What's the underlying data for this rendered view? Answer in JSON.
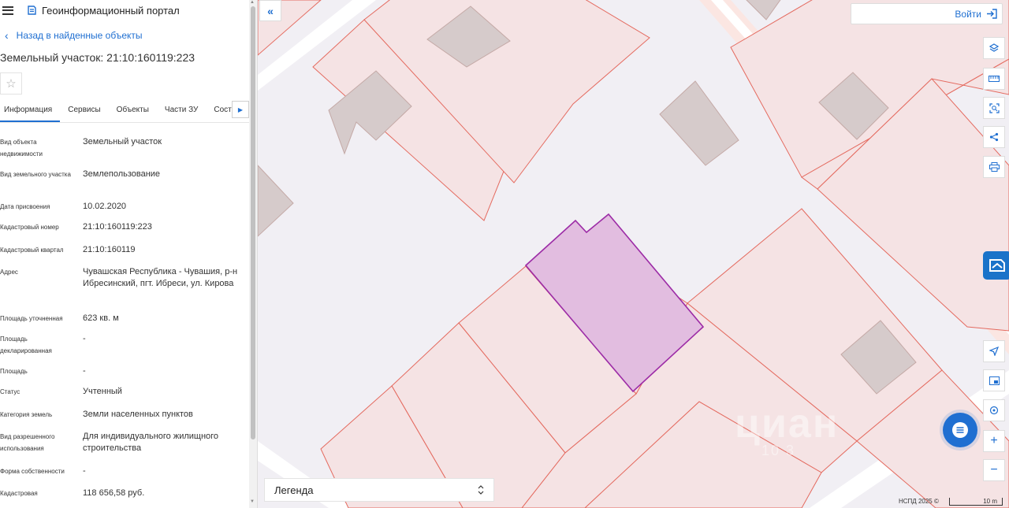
{
  "header": {
    "title": "Геоинформационный портал"
  },
  "back_link": "Назад в найденные объекты",
  "object_title": "Земельный участок: 21:10:160119:223",
  "tabs": [
    {
      "label": "Информация",
      "active": true
    },
    {
      "label": "Сервисы"
    },
    {
      "label": "Объекты"
    },
    {
      "label": "Части ЗУ"
    },
    {
      "label": "Соста"
    }
  ],
  "info": [
    {
      "label": "Вид объекта недвижимости",
      "value": "Земельный участок"
    },
    {
      "label": "Вид земельного участка",
      "value": "Землепользование"
    },
    {
      "label": "Дата присвоения",
      "value": "10.02.2020"
    },
    {
      "label": "Кадастровый номер",
      "value": "21:10:160119:223"
    },
    {
      "label": "Кадастровый квартал",
      "value": "21:10:160119"
    },
    {
      "label": "Адрес",
      "value": "Чувашская Республика - Чувашия, р-н Ибресинский, пгт. Ибреси, ул. Кирова"
    },
    {
      "label": "Площадь уточненная",
      "value": "623 кв. м"
    },
    {
      "label": "Площадь декларированная",
      "value": "-"
    },
    {
      "label": "Площадь",
      "value": "-"
    },
    {
      "label": "Статус",
      "value": "Учтенный"
    },
    {
      "label": "Категория земель",
      "value": "Земли населенных пунктов"
    },
    {
      "label": "Вид разрешенного использования",
      "value": "Для индивидуального жилищного строительства"
    },
    {
      "label": "Форма собственности",
      "value": "-"
    },
    {
      "label": "Кадастровая",
      "value": "118 656,58 руб."
    }
  ],
  "map": {
    "login_label": "Войти",
    "legend_label": "Легенда",
    "credit": "НСПД 2025 ©",
    "scale_label": "10 m",
    "watermark": "циан",
    "watermark_sub": "10 3",
    "selected_fill": "#e2bde0",
    "selected_stroke": "#9c2ba6",
    "parcel_stroke": "#e46a5f",
    "parcel_fill": "#f5e3e4",
    "building_fill": "#d6cbcb"
  },
  "tools": [
    "layers-icon",
    "ruler-icon",
    "area-select-icon",
    "share-icon",
    "print-icon",
    "locate-icon",
    "map-frame-icon",
    "search-map-icon",
    "zoom-in-icon",
    "zoom-out-icon"
  ],
  "accent": "#1f6fd1"
}
